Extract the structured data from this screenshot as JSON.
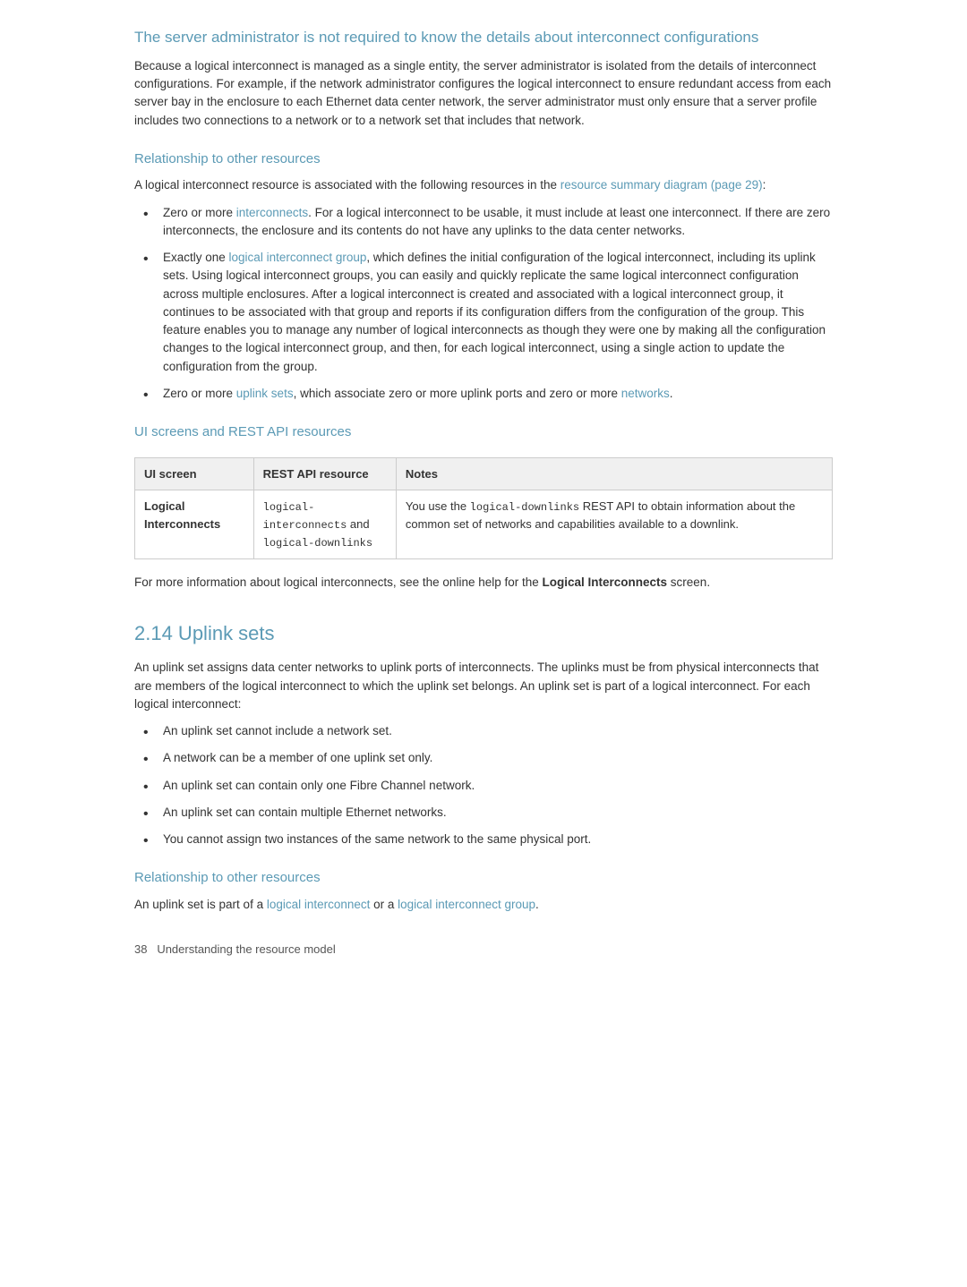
{
  "page": {
    "sections": [
      {
        "id": "server-admin-heading",
        "type": "h2",
        "text": "The server administrator is not required to know the details about interconnect configurations"
      },
      {
        "id": "server-admin-para",
        "type": "paragraph",
        "text": "Because a logical interconnect is managed as a single entity, the server administrator is isolated from the details of interconnect configurations. For example, if the network administrator configures the logical interconnect to ensure redundant access from each server bay in the enclosure to each Ethernet data center network, the server administrator must only ensure that a server profile includes two connections to a network or to a network set that includes that network."
      },
      {
        "id": "relationship-heading-1",
        "type": "h3",
        "text": "Relationship to other resources"
      },
      {
        "id": "relationship-intro",
        "type": "paragraph",
        "parts": [
          {
            "text": "A logical interconnect resource is associated with the following resources in the "
          },
          {
            "text": "resource summary diagram (page 29)",
            "link": true
          },
          {
            "text": ":"
          }
        ]
      },
      {
        "id": "relationship-bullets",
        "type": "bullets",
        "items": [
          {
            "parts": [
              {
                "text": "Zero or more "
              },
              {
                "text": "interconnects",
                "link": true
              },
              {
                "text": ". For a logical interconnect to be usable, it must include at least one interconnect. If there are zero interconnects, the enclosure and its contents do not have any uplinks to the data center networks."
              }
            ]
          },
          {
            "parts": [
              {
                "text": "Exactly one "
              },
              {
                "text": "logical interconnect group",
                "link": true
              },
              {
                "text": ", which defines the initial configuration of the logical interconnect, including its uplink sets. Using logical interconnect groups, you can easily and quickly replicate the same logical interconnect configuration across multiple enclosures. After a logical interconnect is created and associated with a logical interconnect group, it continues to be associated with that group and reports if its configuration differs from the configuration of the group. This feature enables you to manage any number of logical interconnects as though they were one by making all the configuration changes to the logical interconnect group, and then, for each logical interconnect, using a single action to update the configuration from the group."
              }
            ]
          },
          {
            "parts": [
              {
                "text": "Zero or more "
              },
              {
                "text": "uplink sets",
                "link": true
              },
              {
                "text": ", which associate zero or more uplink ports and zero or more "
              },
              {
                "text": "networks",
                "link": true
              },
              {
                "text": "."
              }
            ]
          }
        ]
      },
      {
        "id": "ui-screens-heading",
        "type": "h3",
        "text": "UI screens and REST API resources"
      },
      {
        "id": "table",
        "type": "table",
        "columns": [
          "UI screen",
          "REST API resource",
          "Notes"
        ],
        "rows": [
          {
            "ui_screen": "Logical Interconnects",
            "rest_api": "logical-interconnects and\nlogical-downlinks",
            "notes_parts": [
              {
                "text": "You use the "
              },
              {
                "text": "logical-downlinks",
                "code": true
              },
              {
                "text": " REST API to obtain information about the common set of networks and capabilities available to a downlink."
              }
            ]
          }
        ]
      },
      {
        "id": "more-info-para",
        "type": "paragraph",
        "parts": [
          {
            "text": "For more information about logical interconnects, see the online help for the "
          },
          {
            "text": "Logical Interconnects",
            "bold": true
          },
          {
            "text": " screen."
          }
        ]
      },
      {
        "id": "chapter-heading",
        "type": "chapter",
        "text": "2.14 Uplink sets"
      },
      {
        "id": "uplink-intro",
        "type": "paragraph",
        "text": "An uplink set assigns data center networks to uplink ports of interconnects. The uplinks must be from physical interconnects that are members of the logical interconnect to which the uplink set belongs. An uplink set is part of a logical interconnect. For each logical interconnect:"
      },
      {
        "id": "uplink-bullets",
        "type": "bullets",
        "items": [
          {
            "text": "An uplink set cannot include a network set."
          },
          {
            "text": "A network can be a member of one uplink set only."
          },
          {
            "text": "An uplink set can contain only one Fibre Channel network."
          },
          {
            "text": "An uplink set can contain multiple Ethernet networks."
          },
          {
            "text": "You cannot assign two instances of the same network to the same physical port."
          }
        ]
      },
      {
        "id": "relationship-heading-2",
        "type": "h3",
        "text": "Relationship to other resources"
      },
      {
        "id": "uplink-relationship-para",
        "type": "paragraph",
        "parts": [
          {
            "text": "An uplink set is part of a "
          },
          {
            "text": "logical interconnect",
            "link": true
          },
          {
            "text": " or a "
          },
          {
            "text": "logical interconnect group",
            "link": true
          },
          {
            "text": "."
          }
        ]
      }
    ],
    "footer": {
      "page_number": "38",
      "text": "Understanding the resource model"
    }
  }
}
